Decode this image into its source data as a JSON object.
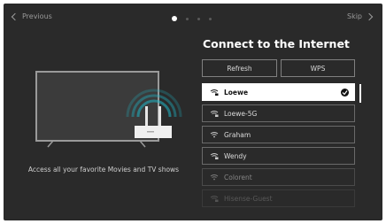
{
  "nav": {
    "previous_label": "Previous",
    "skip_label": "Skip"
  },
  "pager": {
    "total": 4,
    "active": 0
  },
  "left": {
    "tagline": "Access all your favorite Movies and TV shows"
  },
  "right": {
    "title": "Connect to the Internet",
    "refresh_label": "Refresh",
    "wps_label": "WPS",
    "networks": [
      {
        "name": "Loewe",
        "secured": true,
        "selected": true
      },
      {
        "name": "Loewe-5G",
        "secured": true,
        "selected": false
      },
      {
        "name": "Graham",
        "secured": false,
        "selected": false
      },
      {
        "name": "Wendy",
        "secured": true,
        "selected": false
      },
      {
        "name": "Colorent",
        "secured": false,
        "selected": false
      },
      {
        "name": "Hisense-Guest",
        "secured": true,
        "selected": false
      }
    ]
  },
  "colors": {
    "background": "#2a2a2a",
    "accent": "#1fb7c7",
    "selected_bg": "#ffffff"
  }
}
